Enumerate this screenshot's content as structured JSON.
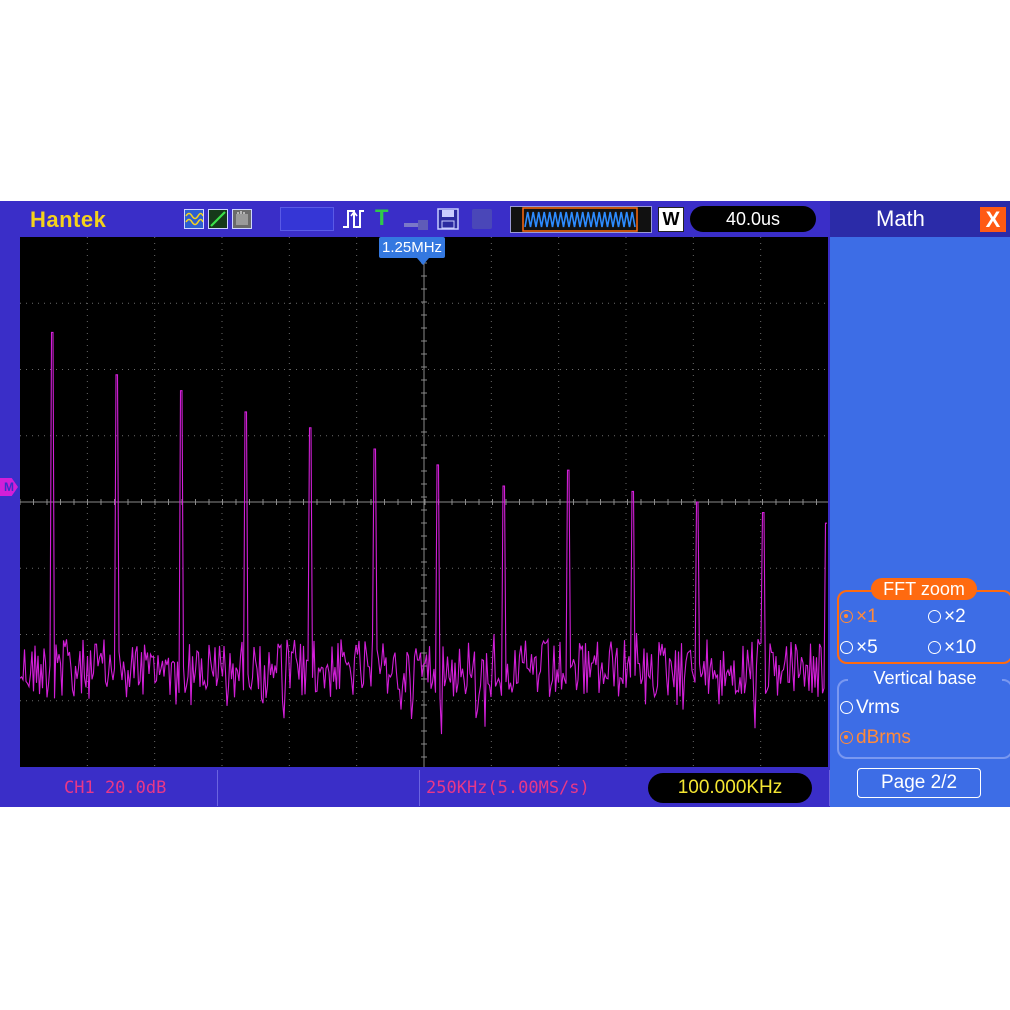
{
  "brand": "Hantek",
  "toolbar": {
    "trigger_icon": "trigger-rising-edge-icon",
    "t_label": "T",
    "w_label": "W",
    "timebase": "40.0us"
  },
  "plot": {
    "trigger_marker": "1.25MHz",
    "math_marker": "M",
    "trace_color": "#d21fd8",
    "peak_heights": [
      0.82,
      0.74,
      0.71,
      0.67,
      0.64,
      0.6,
      0.57,
      0.53,
      0.56,
      0.52,
      0.5,
      0.48,
      0.46
    ]
  },
  "bottombar": {
    "channel_scale": "CH1 20.0dB",
    "sample_rate": "250KHz(5.00MS/s)",
    "frequency": "100.000KHz"
  },
  "menu": {
    "title": "Math",
    "close": "X",
    "fft_zoom": {
      "title": "FFT zoom",
      "options": [
        "×1",
        "×2",
        "×5",
        "×10"
      ],
      "selected": "×1"
    },
    "vertical_base": {
      "title": "Vertical base",
      "options": [
        "Vrms",
        "dBrms"
      ],
      "selected": "dBrms"
    },
    "page": "Page 2/2"
  },
  "colors": {
    "frame": "#3a2ec8",
    "panel": "#3d6de6",
    "accent": "#ff6a10",
    "brand": "#f4d21c"
  }
}
